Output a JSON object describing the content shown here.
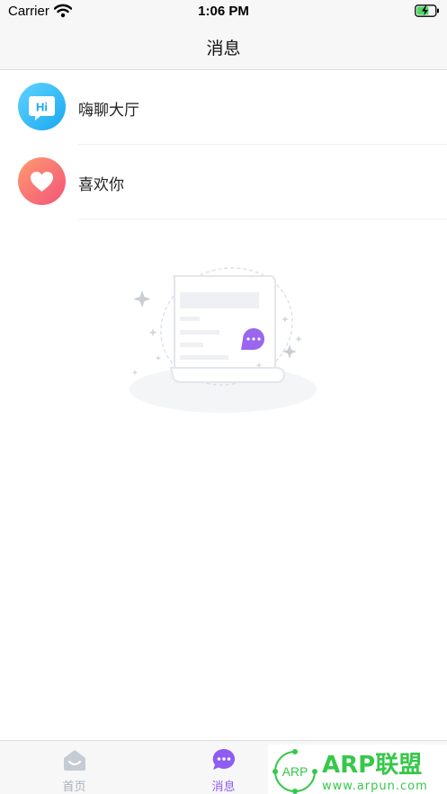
{
  "status_bar": {
    "carrier": "Carrier",
    "time": "1:06 PM"
  },
  "nav": {
    "title": "消息"
  },
  "chats": [
    {
      "label": "嗨聊大厅",
      "avatar_icon": "hi-chat-icon",
      "avatar_text": "Hi",
      "color": "#1aa8f0"
    },
    {
      "label": "喜欢你",
      "avatar_icon": "heart-icon",
      "color": "#f3547a"
    }
  ],
  "tabs": [
    {
      "label": "首页",
      "icon": "home-icon",
      "active": false,
      "color": "#a8b0bc"
    },
    {
      "label": "消息",
      "icon": "chat-bubble-icon",
      "active": true,
      "color": "#8e5cf0"
    }
  ],
  "watermark": {
    "badge": "ARP",
    "title": "ARP联盟",
    "url": "www.arpun.com",
    "color": "#36c84a"
  }
}
